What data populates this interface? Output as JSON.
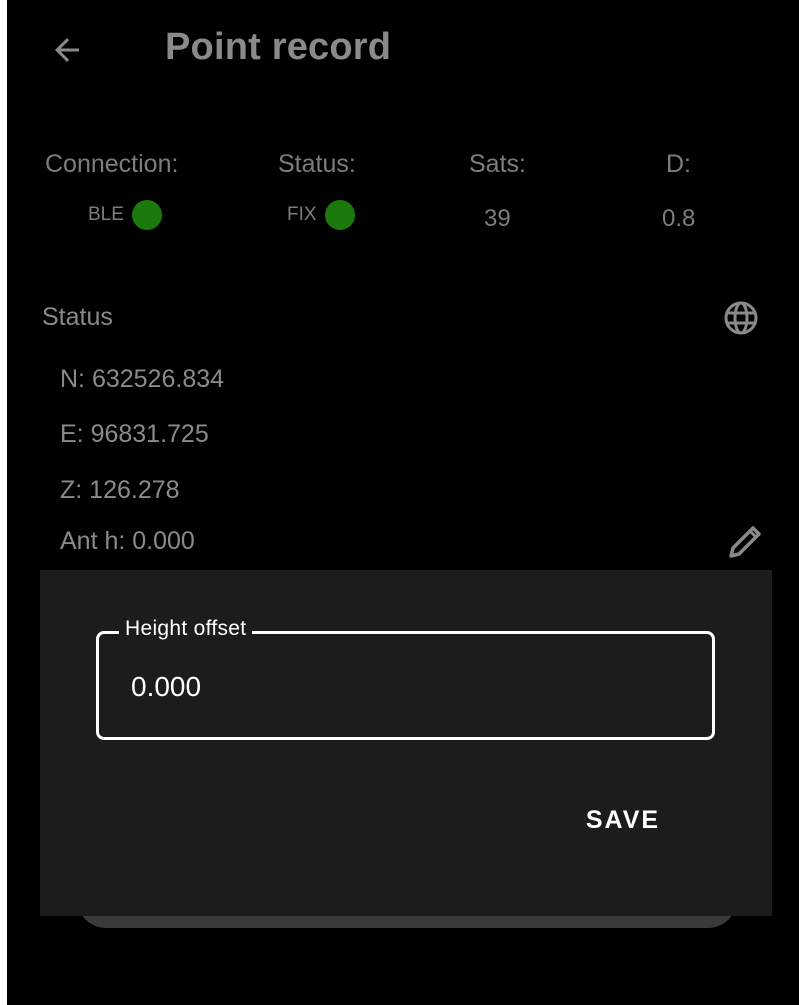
{
  "appbar": {
    "title": "Point record",
    "back_icon": "arrow-left-icon"
  },
  "stats": {
    "connection": {
      "label": "Connection:",
      "value": "BLE",
      "indicator_color": "#1c7a0c"
    },
    "status": {
      "label": "Status:",
      "value": "FIX",
      "indicator_color": "#1c7a0c"
    },
    "sats": {
      "label": "Sats:",
      "value": "39"
    },
    "d": {
      "label": "D:",
      "value": "0.8"
    }
  },
  "status_section": {
    "title": "Status",
    "globe_icon": "globe-icon",
    "n": "N: 632526.834",
    "e": "E: 96831.725",
    "z": "Z: 126.278",
    "ant_h": "Ant h: 0.000",
    "edit_icon": "pencil-icon"
  },
  "dialog": {
    "field_label": "Height offset",
    "field_value": "0.000",
    "save_label": "SAVE"
  }
}
